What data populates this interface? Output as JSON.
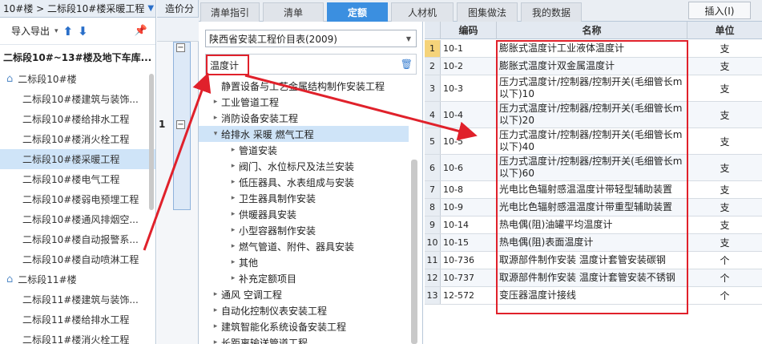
{
  "left_panel": {
    "title": "10#楼 > 二标段10#楼采暖工程",
    "import_export": "导入导出",
    "root": "二标段10#~13#楼及地下车库...",
    "nodes": [
      {
        "label": "二标段10#楼",
        "type": "group"
      },
      {
        "label": "二标段10#楼建筑与装饰...",
        "type": "leaf"
      },
      {
        "label": "二标段10#楼给排水工程",
        "type": "leaf"
      },
      {
        "label": "二标段10#楼消火栓工程",
        "type": "leaf"
      },
      {
        "label": "二标段10#楼采暖工程",
        "type": "leaf",
        "selected": true
      },
      {
        "label": "二标段10#楼电气工程",
        "type": "leaf"
      },
      {
        "label": "二标段10#楼弱电预埋工程",
        "type": "leaf"
      },
      {
        "label": "二标段10#楼通风排烟空...",
        "type": "leaf"
      },
      {
        "label": "二标段10#楼自动报警系...",
        "type": "leaf"
      },
      {
        "label": "二标段10#楼自动喷淋工程",
        "type": "leaf"
      },
      {
        "label": "二标段11#楼",
        "type": "group"
      },
      {
        "label": "二标段11#楼建筑与装饰...",
        "type": "leaf"
      },
      {
        "label": "二标段11#楼给排水工程",
        "type": "leaf"
      },
      {
        "label": "二标段11#楼消火栓工程",
        "type": "leaf"
      }
    ]
  },
  "middle": {
    "tab_label": "造价分",
    "row_number": "1"
  },
  "tabs": {
    "items": [
      "清单指引",
      "清单",
      "定额",
      "人材机",
      "图集做法",
      "我的数据"
    ],
    "active": "定额",
    "insert_button": "插入(I)"
  },
  "library": {
    "selected_library": "陕西省安装工程价目表(2009)",
    "search_value": "温度计",
    "tree": [
      {
        "label": "静置设备与工艺金属结构制作安装工程",
        "level": 0,
        "arrow": ""
      },
      {
        "label": "工业管道工程",
        "level": 0,
        "arrow": "▸"
      },
      {
        "label": "消防设备安装工程",
        "level": 0,
        "arrow": "▸"
      },
      {
        "label": "给排水 采暖 燃气工程",
        "level": 0,
        "arrow": "▾",
        "highlight": true
      },
      {
        "label": "管道安装",
        "level": 1,
        "arrow": "▸"
      },
      {
        "label": "阀门、水位标尺及法兰安装",
        "level": 1,
        "arrow": "▸"
      },
      {
        "label": "低压器具、水表组成与安装",
        "level": 1,
        "arrow": "▸"
      },
      {
        "label": "卫生器具制作安装",
        "level": 1,
        "arrow": "▸"
      },
      {
        "label": "供暖器具安装",
        "level": 1,
        "arrow": "▸"
      },
      {
        "label": "小型容器制作安装",
        "level": 1,
        "arrow": "▸"
      },
      {
        "label": "燃气管道、附件、器具安装",
        "level": 1,
        "arrow": "▸"
      },
      {
        "label": "其他",
        "level": 1,
        "arrow": "▸"
      },
      {
        "label": "补充定额项目",
        "level": 1,
        "arrow": "▸"
      },
      {
        "label": "通风 空调工程",
        "level": 0,
        "arrow": "▸"
      },
      {
        "label": "自动化控制仪表安装工程",
        "level": 0,
        "arrow": "▸"
      },
      {
        "label": "建筑智能化系统设备安装工程",
        "level": 0,
        "arrow": "▸"
      },
      {
        "label": "长距离输送管道工程",
        "level": 0,
        "arrow": "▸"
      }
    ]
  },
  "table": {
    "headers": {
      "code": "编码",
      "name": "名称",
      "unit": "单位"
    },
    "rows": [
      {
        "n": "1",
        "code": "10-1",
        "name": "膨胀式温度计工业液体温度计",
        "unit": "支",
        "tall": false
      },
      {
        "n": "2",
        "code": "10-2",
        "name": "膨胀式温度计双金属温度计",
        "unit": "支",
        "tall": false
      },
      {
        "n": "3",
        "code": "10-3",
        "name": "压力式温度计/控制器/控制开关(毛细管长m以下)10",
        "unit": "支",
        "tall": true
      },
      {
        "n": "4",
        "code": "10-4",
        "name": "压力式温度计/控制器/控制开关(毛细管长m以下)20",
        "unit": "支",
        "tall": true
      },
      {
        "n": "5",
        "code": "10-5",
        "name": "压力式温度计/控制器/控制开关(毛细管长m以下)40",
        "unit": "支",
        "tall": true
      },
      {
        "n": "6",
        "code": "10-6",
        "name": "压力式温度计/控制器/控制开关(毛细管长m以下)60",
        "unit": "支",
        "tall": true
      },
      {
        "n": "7",
        "code": "10-8",
        "name": "光电比色辐射感温温度计带轻型辅助装置",
        "unit": "支",
        "tall": false
      },
      {
        "n": "8",
        "code": "10-9",
        "name": "光电比色辐射感温温度计带重型辅助装置",
        "unit": "支",
        "tall": false
      },
      {
        "n": "9",
        "code": "10-14",
        "name": "热电偶(阻)油罐平均温度计",
        "unit": "支",
        "tall": false
      },
      {
        "n": "10",
        "code": "10-15",
        "name": "热电偶(阻)表面温度计",
        "unit": "支",
        "tall": false
      },
      {
        "n": "11",
        "code": "10-736",
        "name": "取源部件制作安装 温度计套管安装碳钢",
        "unit": "个",
        "tall": false
      },
      {
        "n": "12",
        "code": "10-737",
        "name": "取源部件制作安装 温度计套管安装不锈钢",
        "unit": "个",
        "tall": false
      },
      {
        "n": "13",
        "code": "12-572",
        "name": "变压器温度计接线",
        "unit": "个",
        "tall": false
      }
    ]
  },
  "colors": {
    "accent": "#3b8fe0",
    "highlight_red": "#e0212b",
    "selection": "#cfe4f8"
  }
}
